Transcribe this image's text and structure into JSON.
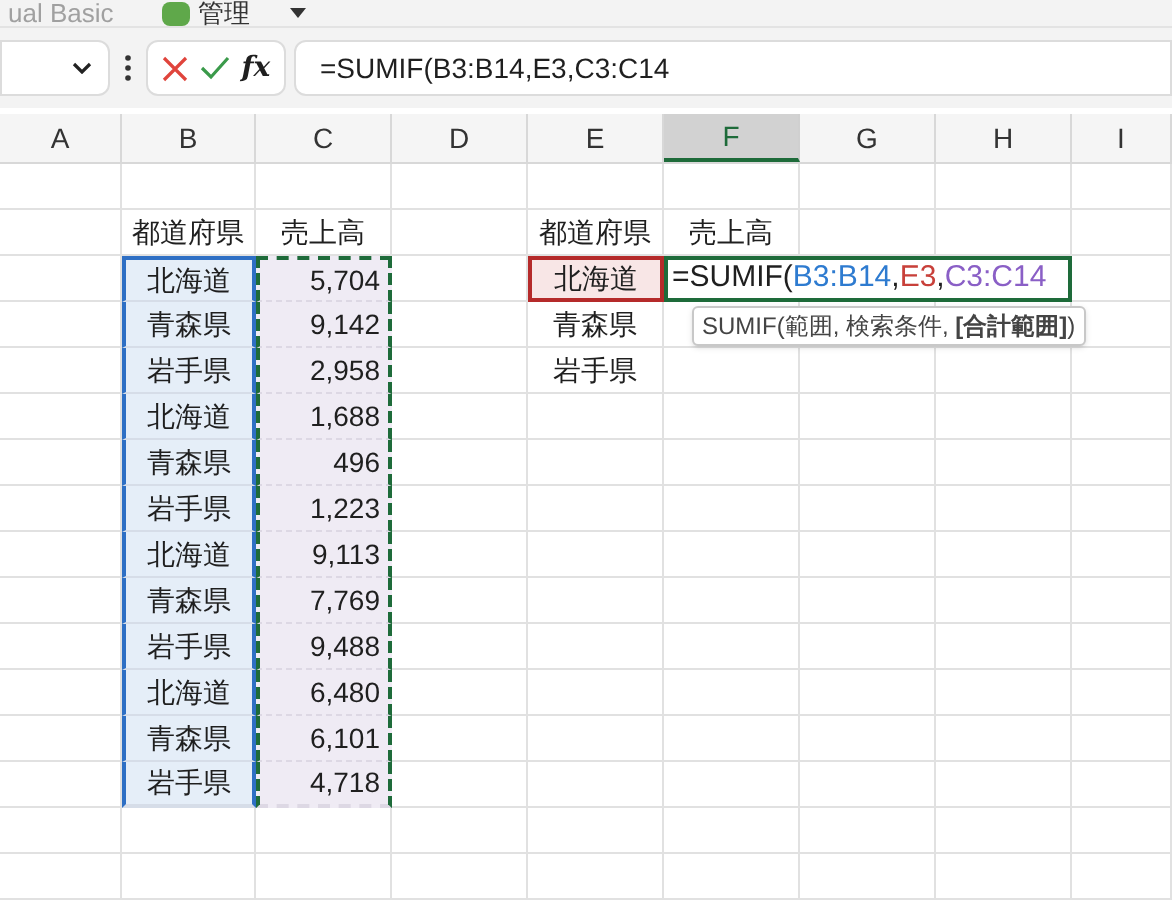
{
  "ribbon": {
    "items": [
      {
        "label": "ual Basic",
        "kind": "text"
      },
      {
        "label": "管理",
        "kind": "menu"
      }
    ]
  },
  "formula_bar": {
    "function_label": "fx",
    "formula": "=SUMIF(B3:B14,E3,C3:C14"
  },
  "columns": [
    {
      "label": "A",
      "selected": false
    },
    {
      "label": "B",
      "selected": false
    },
    {
      "label": "C",
      "selected": false
    },
    {
      "label": "D",
      "selected": false
    },
    {
      "label": "E",
      "selected": false
    },
    {
      "label": "F",
      "selected": true
    },
    {
      "label": "G",
      "selected": false
    },
    {
      "label": "H",
      "selected": false
    },
    {
      "label": "I",
      "selected": false
    }
  ],
  "left_table": {
    "headers": [
      "都道府県",
      "売上高"
    ],
    "rows": [
      {
        "prefecture": "北海道",
        "sales": "5,704"
      },
      {
        "prefecture": "青森県",
        "sales": "9,142"
      },
      {
        "prefecture": "岩手県",
        "sales": "2,958"
      },
      {
        "prefecture": "北海道",
        "sales": "1,688"
      },
      {
        "prefecture": "青森県",
        "sales": "496"
      },
      {
        "prefecture": "岩手県",
        "sales": "1,223"
      },
      {
        "prefecture": "北海道",
        "sales": "9,113"
      },
      {
        "prefecture": "青森県",
        "sales": "7,769"
      },
      {
        "prefecture": "岩手県",
        "sales": "9,488"
      },
      {
        "prefecture": "北海道",
        "sales": "6,480"
      },
      {
        "prefecture": "青森県",
        "sales": "6,101"
      },
      {
        "prefecture": "岩手県",
        "sales": "4,718"
      }
    ]
  },
  "right_table": {
    "headers": [
      "都道府県",
      "売上高"
    ],
    "rows": [
      "北海道",
      "青森県",
      "岩手県"
    ]
  },
  "cell_edit": {
    "segments": [
      {
        "text": "=SUMIF(",
        "color": "#1f1f1f"
      },
      {
        "text": "B3:B14",
        "color": "#2e7bd0"
      },
      {
        "text": ",",
        "color": "#1f1f1f"
      },
      {
        "text": "E3",
        "color": "#c8403a"
      },
      {
        "text": ",",
        "color": "#1f1f1f"
      },
      {
        "text": "C3:C14",
        "color": "#8a5fc6"
      }
    ],
    "tooltip": "SUMIF(範囲, 検索条件, **[合計範囲]**)"
  }
}
